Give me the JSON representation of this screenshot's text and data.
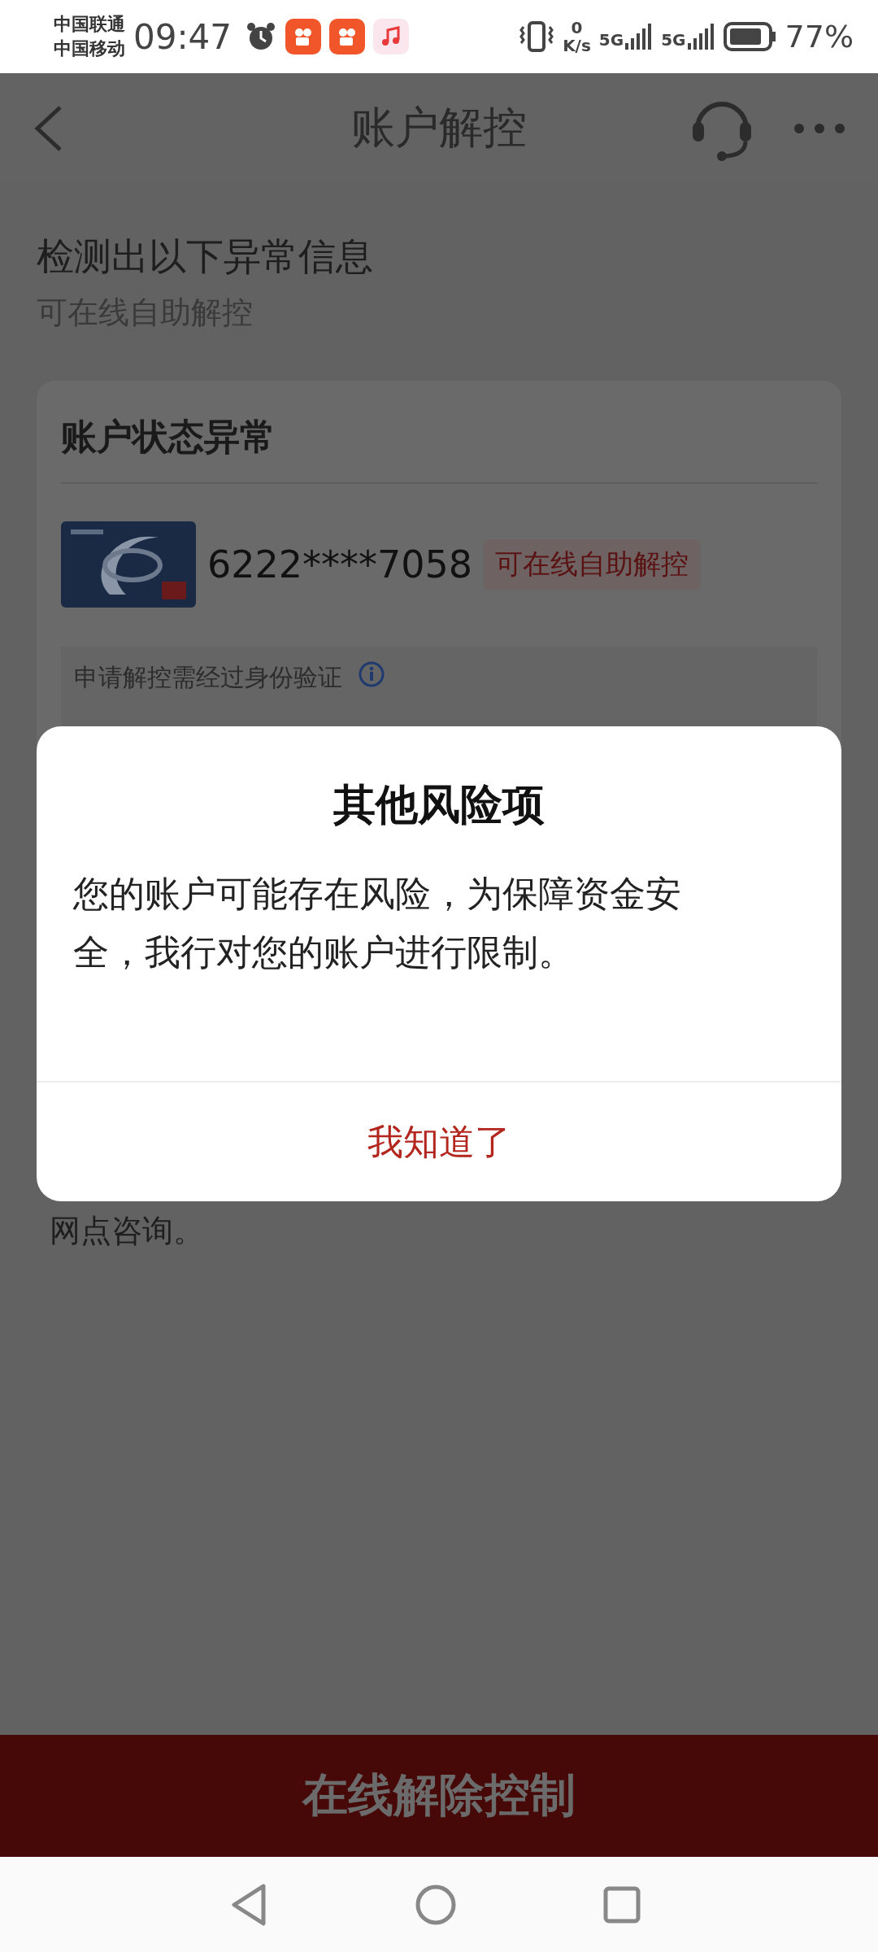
{
  "status_bar": {
    "carriers": [
      "中国联通",
      "中国移动"
    ],
    "time": "09:47",
    "net_speed_value": "0",
    "net_speed_unit": "K/s",
    "signals": [
      "5G",
      "5G"
    ],
    "battery": "77%"
  },
  "header": {
    "title": "账户解控"
  },
  "intro": {
    "title": "检测出以下异常信息",
    "subtitle": "可在线自助解控"
  },
  "card": {
    "title": "账户状态异常",
    "account": {
      "number": "6222****7058",
      "tag": "可在线自助解控"
    },
    "notice": "申请解控需经过身份验证"
  },
  "footnote": "网点咨询。",
  "dialog": {
    "title": "其他风险项",
    "message": "您的账户可能存在风险，为保障资金安全，我行对您的账户进行限制。",
    "button": "我知道了"
  },
  "bottom_button": "在线解除控制"
}
